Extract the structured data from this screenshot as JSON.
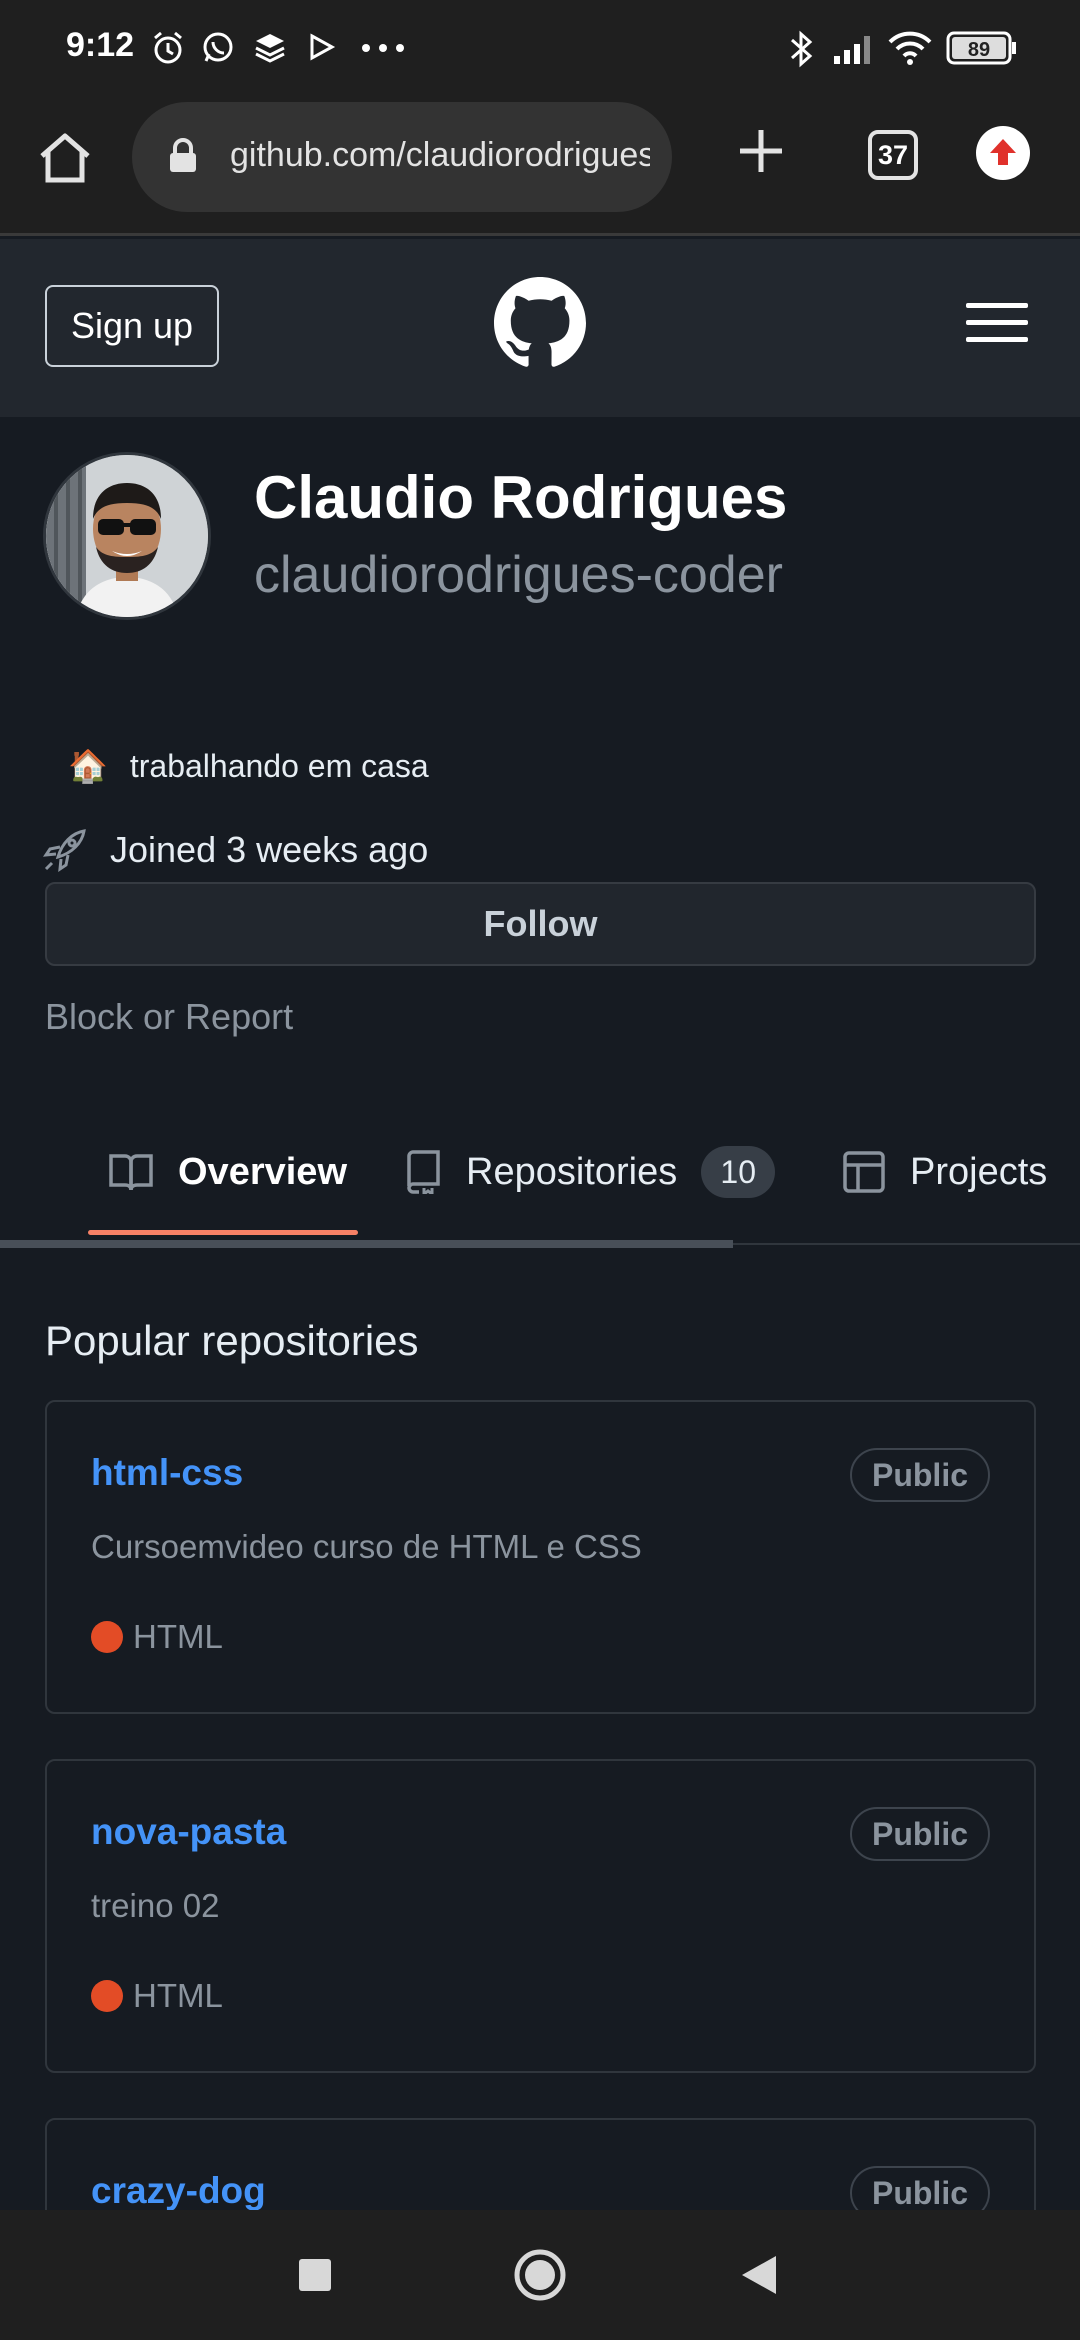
{
  "status_bar": {
    "time": "9:12",
    "icons": [
      "alarm-icon",
      "whatsapp-icon",
      "layers-icon",
      "play-icon",
      "more-dots-icon"
    ],
    "right_icons": [
      "bluetooth-icon",
      "signal-icon",
      "wifi-icon",
      "battery-icon"
    ],
    "battery": "89"
  },
  "browser": {
    "url": "github.com/claudiorodrigues-coder",
    "tab_count": "37",
    "icons": [
      "home-icon",
      "lock-icon",
      "new-tab-plus-icon",
      "tab-switcher-icon",
      "extension-upload-icon"
    ]
  },
  "github_header": {
    "signup_label": "Sign up",
    "logo": "github-octocat-icon",
    "menu": "hamburger-menu-icon"
  },
  "profile": {
    "full_name": "Claudio Rodrigues",
    "username": "claudiorodrigues-coder",
    "status_emoji": "🏠",
    "status_text": "trabalhando em casa",
    "joined_text": "Joined 3 weeks ago",
    "follow_label": "Follow",
    "block_report_label": "Block or Report"
  },
  "tabs": [
    {
      "label": "Overview",
      "icon": "book-icon",
      "active": true
    },
    {
      "label": "Repositories",
      "icon": "repo-icon",
      "count": "10"
    },
    {
      "label": "Projects",
      "icon": "table-icon"
    }
  ],
  "popular": {
    "title": "Popular repositories",
    "repos": [
      {
        "name": "html-css",
        "visibility": "Public",
        "description": "Cursoemvideo curso de HTML e CSS",
        "language": "HTML",
        "language_color": "#e34c26"
      },
      {
        "name": "nova-pasta",
        "visibility": "Public",
        "description": "treino 02",
        "language": "HTML",
        "language_color": "#e34c26"
      },
      {
        "name": "crazy-dog",
        "visibility": "Public"
      }
    ]
  },
  "colors": {
    "background": "#161b22",
    "header": "#22272e",
    "link": "#4493f8",
    "tab_underline": "#f78166",
    "html_language": "#e34c26"
  },
  "nav_bar": {
    "icons": [
      "recents-square-icon",
      "home-circle-icon",
      "back-triangle-icon"
    ]
  }
}
